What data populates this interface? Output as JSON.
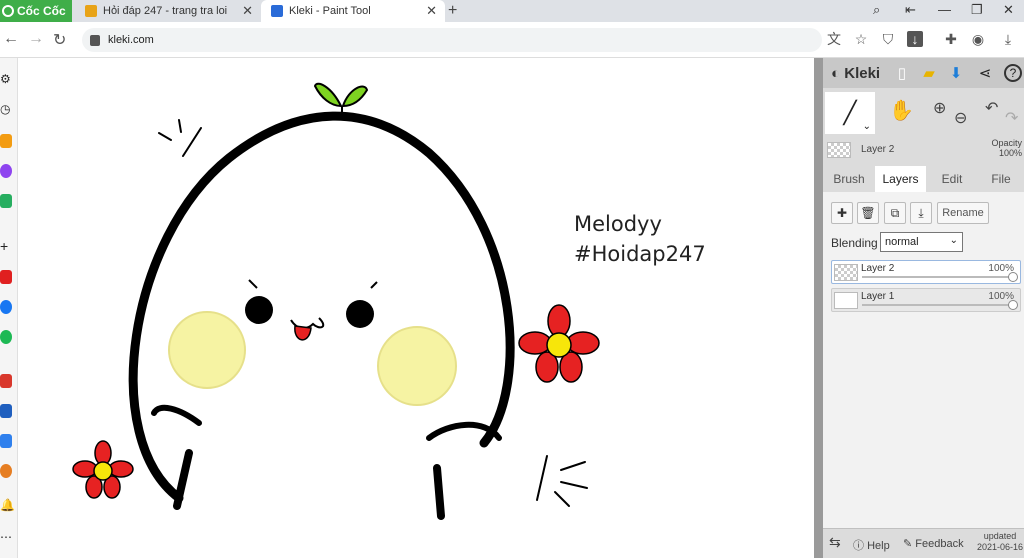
{
  "browser": {
    "brand": "Cốc Cốc",
    "tabs": [
      {
        "title": "Hỏi đáp 247 - trang tra loi"
      },
      {
        "title": "Kleki - Paint Tool"
      }
    ],
    "new_tab": "+",
    "url": "kleki.com"
  },
  "canvas": {
    "text_line1": "Melodyy",
    "text_line2": "#Hoidap247"
  },
  "kleki": {
    "brand": "Kleki",
    "current_layer": "Layer 2",
    "opacity_label": "Opacity",
    "opacity_value": "100%",
    "tabs": [
      "Brush",
      "Layers",
      "Edit",
      "File"
    ],
    "active_tab": "Layers",
    "rename_label": "Rename",
    "blending_label": "Blending",
    "blending_value": "normal",
    "layers": [
      {
        "name": "Layer 2",
        "opacity": "100%"
      },
      {
        "name": "Layer 1",
        "opacity": "100%"
      }
    ],
    "help_label": "Help",
    "feedback_label": "Feedback",
    "updated_label": "updated",
    "updated_date": "2021-06-16"
  },
  "colors": {
    "tab_brand": "#3fae49",
    "outline": "#000000",
    "cheek": "#f6f3a3",
    "flower_petal": "#e62222",
    "flower_center": "#f7e60a",
    "sprout": "#7ed321"
  }
}
